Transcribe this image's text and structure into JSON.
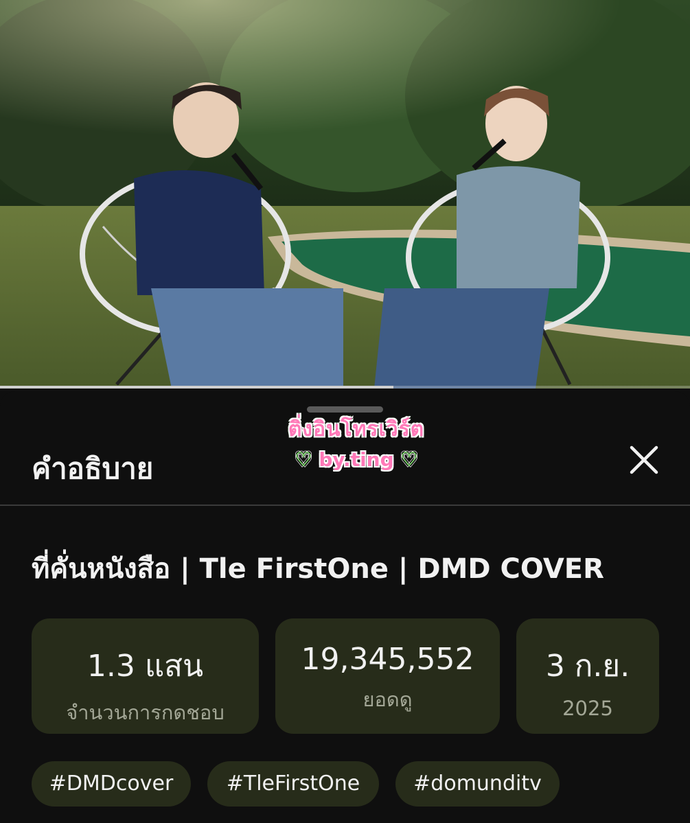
{
  "video": {
    "progress_fraction": 0.57
  },
  "sheet": {
    "title": "คำอธิบาย",
    "close_icon": "close-icon",
    "watermark": {
      "line1": "ติ่งอินโทรเวิร์ต",
      "line2_heart_left": "♡",
      "line2_text": "by.ting",
      "line2_heart_right": "♡"
    }
  },
  "details": {
    "video_title": "ที่คั่นหนังสือ | Tle FirstOne | DMD COVER",
    "stats": [
      {
        "value": "1.3 แสน",
        "label": "จำนวนการกดชอบ"
      },
      {
        "value": "19,345,552",
        "label": "ยอดดู"
      },
      {
        "value": "3 ก.ย.",
        "label": "2025"
      }
    ],
    "hashtags": [
      "#DMDcover",
      "#TleFirstOne",
      "#domunditv"
    ]
  },
  "colors": {
    "background": "#0f0f0f",
    "chip_background": "#272c1a",
    "text_primary": "#f1f1f1",
    "text_secondary": "#a3a796"
  }
}
